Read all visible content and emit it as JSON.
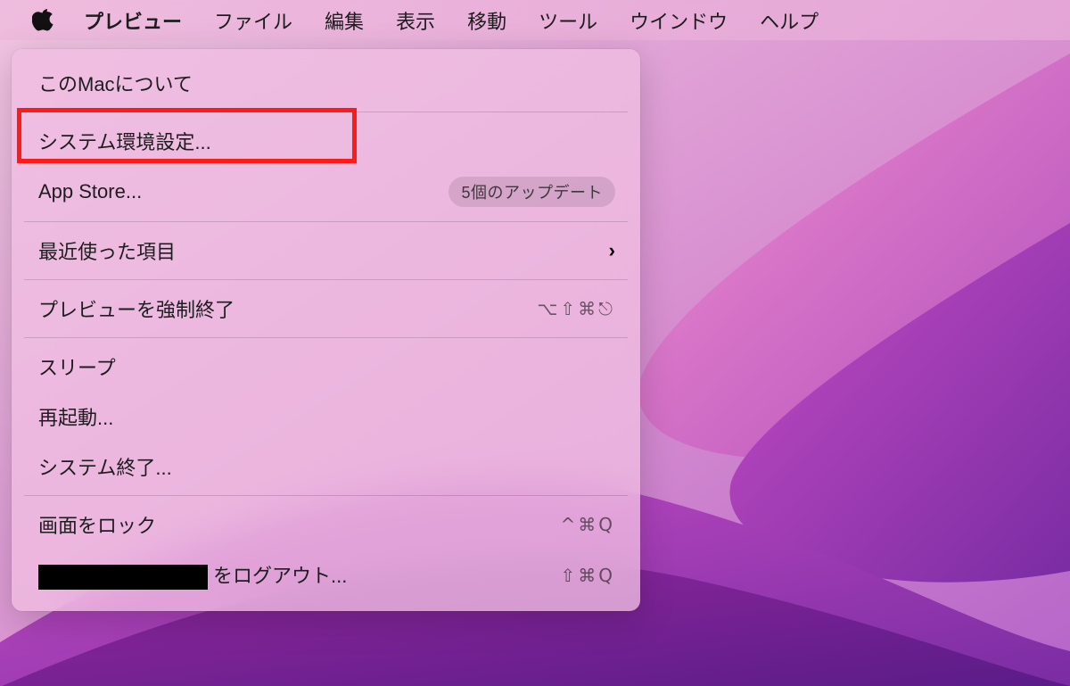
{
  "menubar": {
    "app_name": "プレビュー",
    "items": [
      "ファイル",
      "編集",
      "表示",
      "移動",
      "ツール",
      "ウインドウ",
      "ヘルプ"
    ]
  },
  "apple_menu": {
    "about": "このMacについて",
    "system_preferences": "システム環境設定...",
    "app_store": {
      "label": "App Store...",
      "badge": "5個のアップデート"
    },
    "recent_items": {
      "label": "最近使った項目",
      "chevron": "›"
    },
    "force_quit": {
      "label": "プレビューを強制終了",
      "shortcut": "⌥⇧⌘⎋"
    },
    "sleep": "スリープ",
    "restart": "再起動...",
    "shutdown": "システム終了...",
    "lock_screen": {
      "label": "画面をロック",
      "shortcut": "^⌘Q"
    },
    "logout": {
      "suffix": "をログアウト...",
      "shortcut": "⇧⌘Q"
    }
  },
  "annotation": {
    "highlight_target": "system_preferences"
  },
  "colors": {
    "highlight": "#ff1a1a",
    "menubar_tint": "rgba(236,180,218,0.55)",
    "dropdown_tint": "rgba(240,190,225,0.78)"
  }
}
